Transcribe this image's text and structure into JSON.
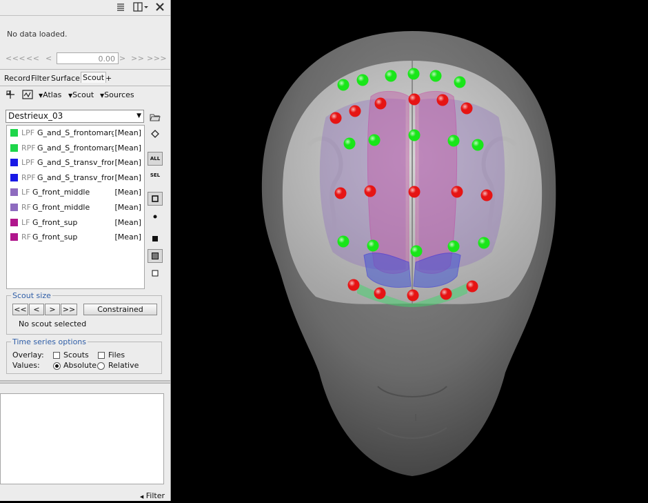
{
  "panel": {
    "topbar_icons": [
      "list-icon",
      "layout-icon",
      "close-icon"
    ],
    "status_text": "No data loaded.",
    "time_nav": {
      "back_far": "<<<",
      "back_more": "<<",
      "back_one": "<",
      "value": "0.00",
      "fwd_one": ">",
      "fwd_more": ">>",
      "fwd_far": ">>>"
    },
    "tabs": [
      "Record",
      "Filter",
      "Surface",
      "Scout",
      "+"
    ],
    "active_tab": "Scout",
    "toolbar": {
      "atlas": "Atlas",
      "scout": "Scout",
      "sources": "Sources"
    },
    "atlas_name": "Destrieux_03",
    "scouts": [
      {
        "hemi": "LPF",
        "name": "G_and_S_frontomargin",
        "mode": "[Mean]",
        "color": "#1ed64a"
      },
      {
        "hemi": "RPF",
        "name": "G_and_S_frontomargin",
        "mode": "[Mean]",
        "color": "#1ed64a"
      },
      {
        "hemi": "LPF",
        "name": "G_and_S_transv_frontopol",
        "mode": "[Mean]",
        "color": "#1919e6"
      },
      {
        "hemi": "RPF",
        "name": "G_and_S_transv_frontopol",
        "mode": "[Mean]",
        "color": "#1919e6"
      },
      {
        "hemi": "LF",
        "name": "G_front_middle",
        "mode": "[Mean]",
        "color": "#8e6bbf"
      },
      {
        "hemi": "RF",
        "name": "G_front_middle",
        "mode": "[Mean]",
        "color": "#8e6bbf"
      },
      {
        "hemi": "LF",
        "name": "G_front_sup",
        "mode": "[Mean]",
        "color": "#b0168c"
      },
      {
        "hemi": "RF",
        "name": "G_front_sup",
        "mode": "[Mean]",
        "color": "#b0168c"
      }
    ],
    "side_tools": {
      "all_label": "ALL",
      "sel_label": "SEL"
    },
    "scout_size": {
      "title": "Scout size",
      "btn_shrink_all": "<<",
      "btn_shrink": "<",
      "btn_grow": ">",
      "btn_grow_all": ">>",
      "constrained": "Constrained",
      "status": "No scout selected"
    },
    "time_series": {
      "title": "Time series options",
      "overlay_label": "Overlay:",
      "scouts_label": "Scouts",
      "files_label": "Files",
      "values_label": "Values:",
      "absolute_label": "Absolute",
      "relative_label": "Relative",
      "values_selected": "Absolute"
    },
    "filter_label": "Filter"
  },
  "viewport": {
    "sensor_colors": {
      "green": "#19e619",
      "red": "#e61414"
    }
  }
}
